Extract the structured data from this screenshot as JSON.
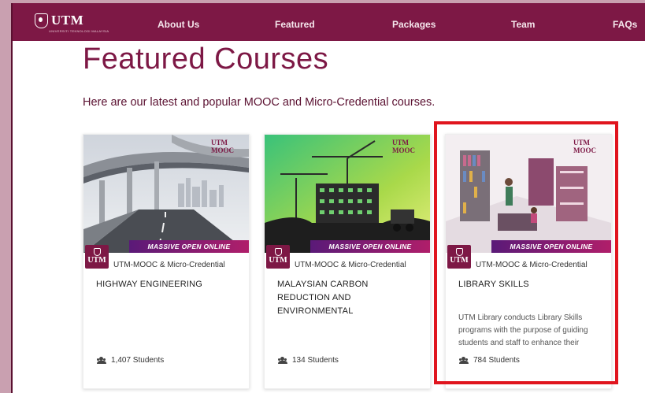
{
  "nav": {
    "brand": "UTM",
    "brand_sub": "UNIVERSITI TEKNOLOGI MALAYSIA",
    "items": [
      {
        "label": "About Us"
      },
      {
        "label": "Featured"
      },
      {
        "label": "Packages"
      },
      {
        "label": "Team"
      },
      {
        "label": "FAQs"
      }
    ]
  },
  "main": {
    "title": "Featured Courses",
    "intro": "Here are our latest and popular MOOC and Micro-Credential courses."
  },
  "banner": {
    "ribbon": "MASSIVE OPEN ONLINE LEARNING",
    "badge_line1": "UTM",
    "badge_line2": "MOOC",
    "provider_logo": "UTM"
  },
  "courses": [
    {
      "provider": "UTM-MOOC & Micro-Credential",
      "title": "HIGHWAY ENGINEERING",
      "description": "",
      "students": "1,407 Students",
      "image": "highway-illustration"
    },
    {
      "provider": "UTM-MOOC & Micro-Credential",
      "title": "MALAYSIAN CARBON REDUCTION AND ENVIRONMENTAL",
      "description": "",
      "students": "134 Students",
      "image": "construction-illustration"
    },
    {
      "provider": "UTM-MOOC & Micro-Credential",
      "title": "LIBRARY SKILLS",
      "description": "UTM Library conducts Library Skills programs with the purpose of guiding students and staff to enhance their",
      "students": "784 Students",
      "image": "library-illustration"
    }
  ],
  "colors": {
    "brand": "#7d1845",
    "highlight": "#e0151e",
    "page_bg": "#c9a0b0"
  }
}
